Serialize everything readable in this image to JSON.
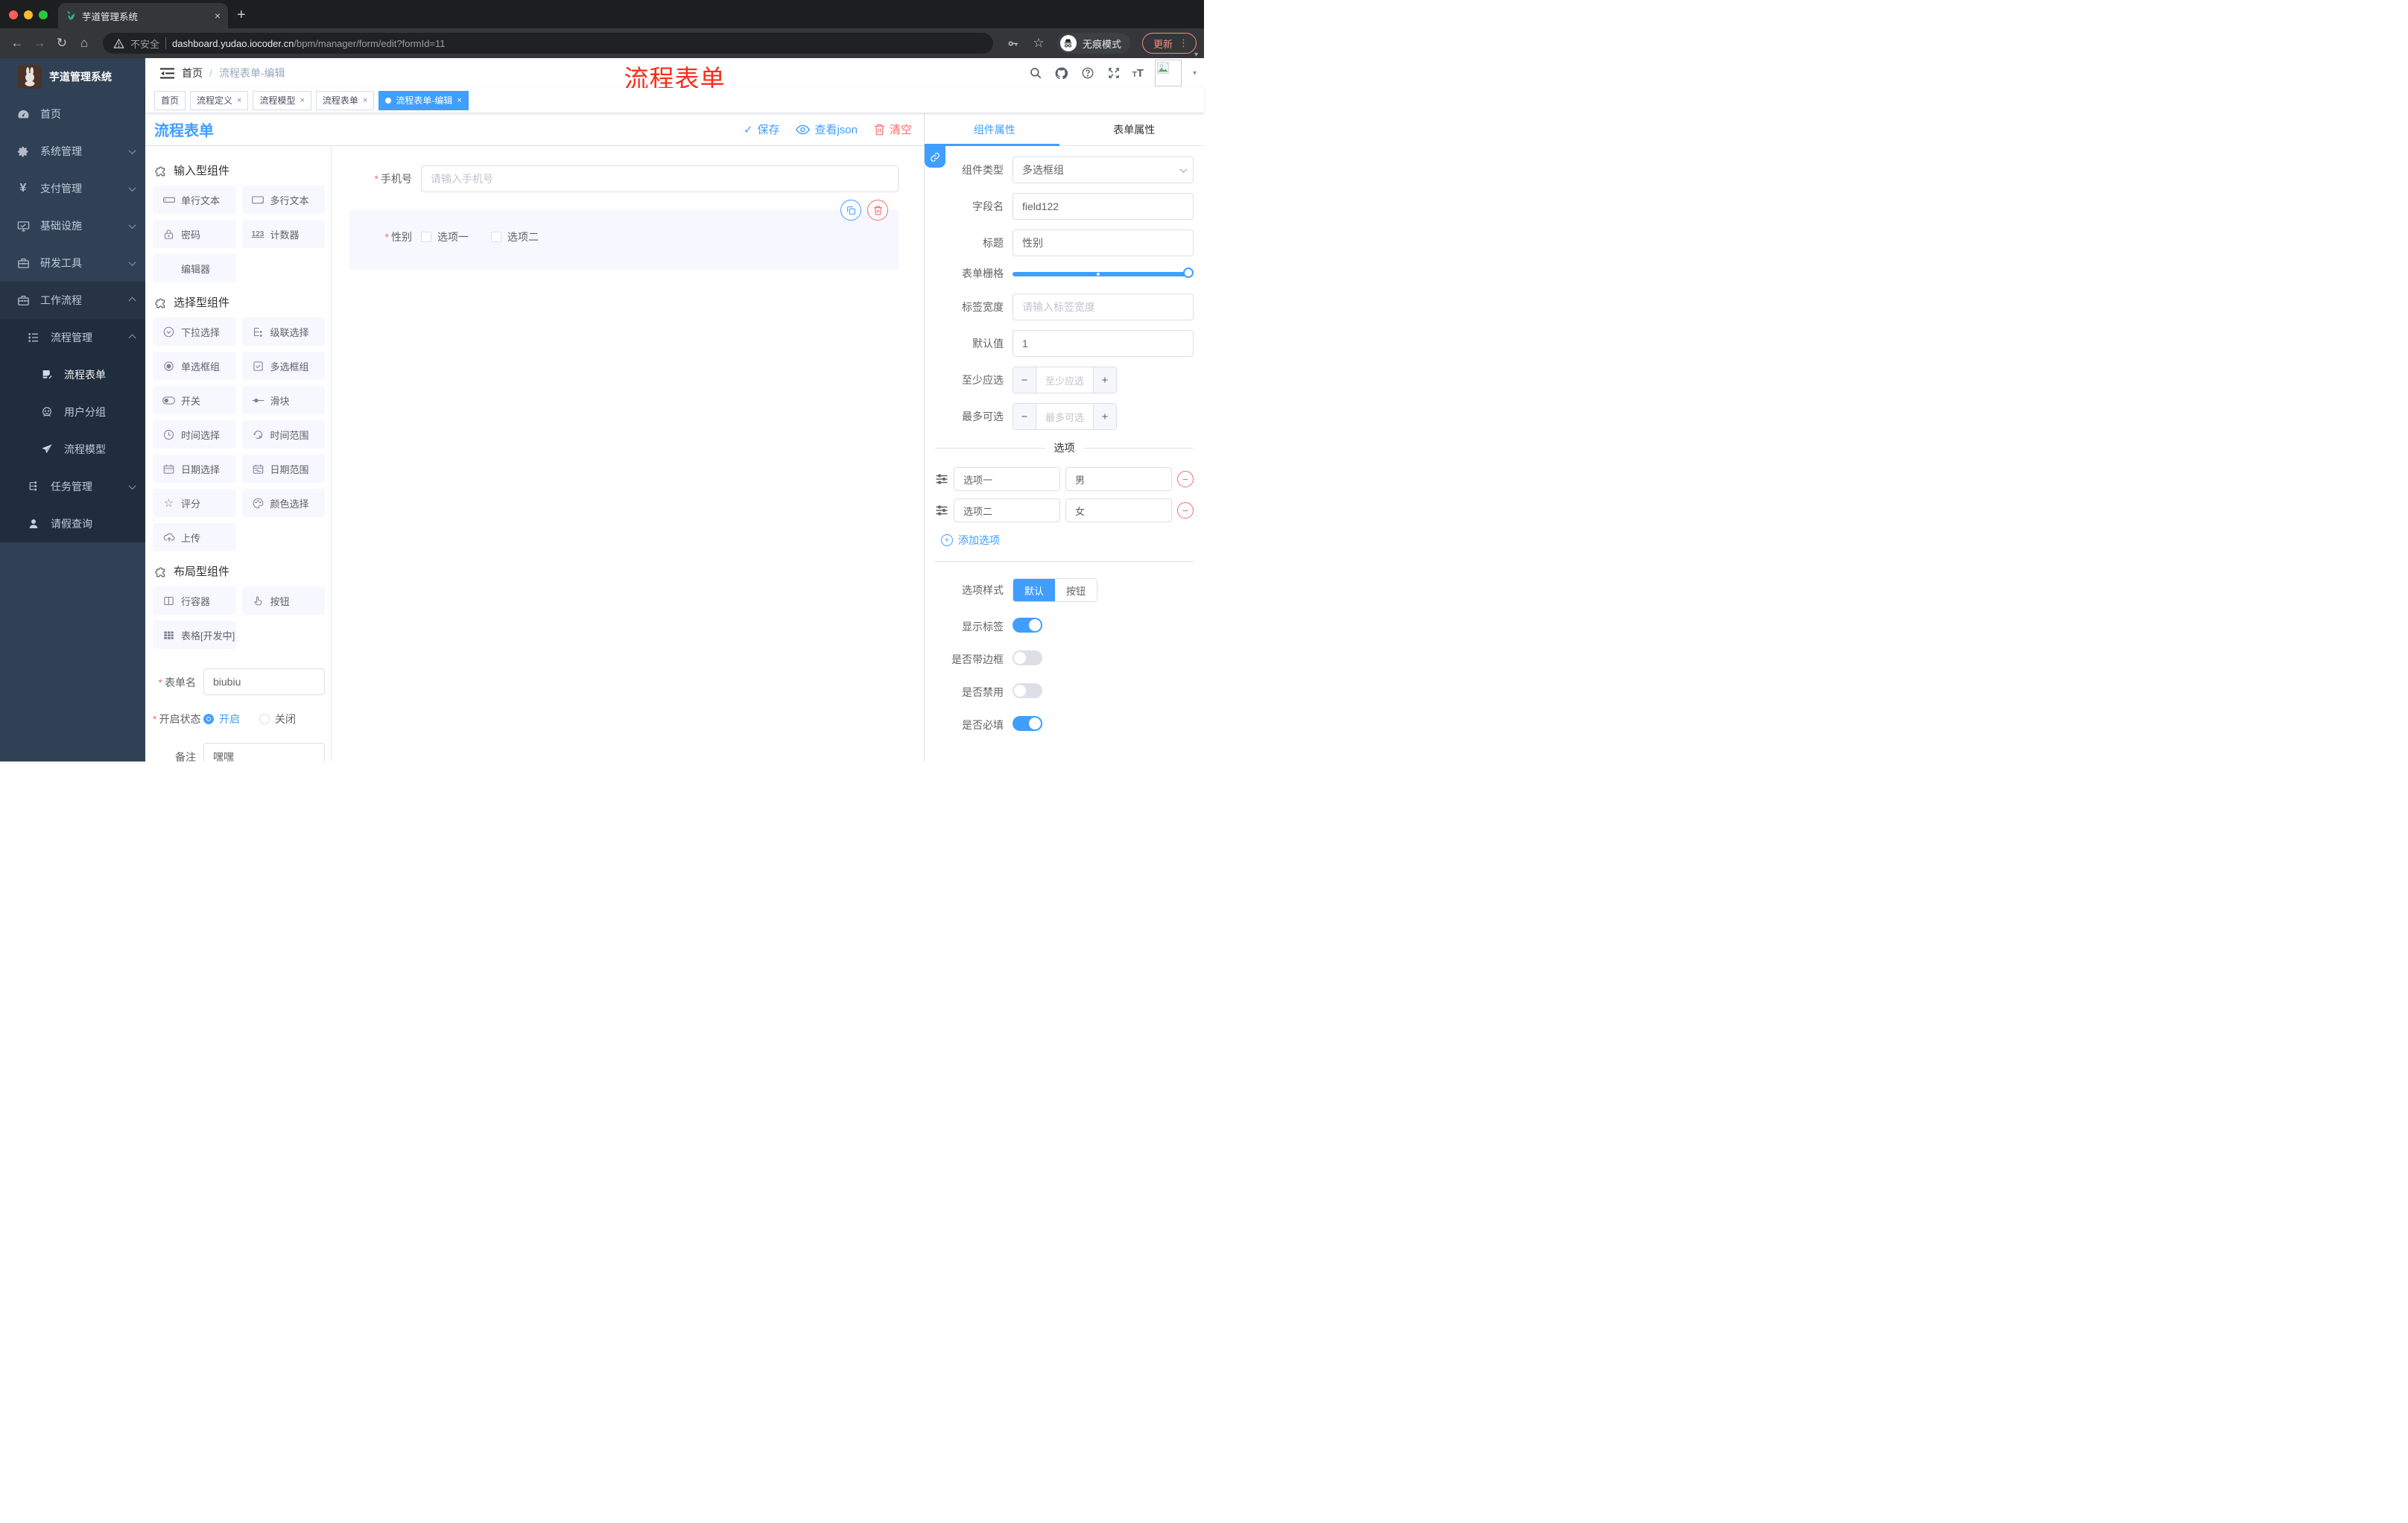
{
  "browser": {
    "tab_title": "芋道管理系统",
    "close_tab": "×",
    "new_tab": "+",
    "back": "←",
    "forward": "→",
    "reload": "↻",
    "home": "⌂",
    "security_label": "不安全",
    "url_domain": "dashboard.yudao.iocoder.cn",
    "url_path": "/bpm/manager/form/edit?formId=11",
    "incognito_label": "无痕模式",
    "update_label": "更新",
    "menu_dots": "⋮",
    "caret": "▾"
  },
  "sidebar": {
    "logo_title": "芋道管理系统",
    "items": [
      {
        "label": "首页",
        "icon": "dashboard-icon"
      },
      {
        "label": "系统管理",
        "icon": "gear-icon"
      },
      {
        "label": "支付管理",
        "icon": "yen-icon",
        "yen": "¥"
      },
      {
        "label": "基础设施",
        "icon": "monitor-icon"
      },
      {
        "label": "研发工具",
        "icon": "toolbox-icon"
      },
      {
        "label": "工作流程",
        "icon": "workflow-icon"
      }
    ],
    "submenu": [
      {
        "label": "流程管理",
        "icon": "list-icon"
      },
      {
        "label": "流程表单",
        "icon": "doc-edit-icon"
      },
      {
        "label": "用户分组",
        "icon": "face-icon"
      },
      {
        "label": "流程模型",
        "icon": "send-icon"
      },
      {
        "label": "任务管理",
        "icon": "tree-icon"
      },
      {
        "label": "请假查询",
        "icon": "user-icon"
      }
    ]
  },
  "header": {
    "breadcrumb": {
      "home": "首页",
      "sep": "/",
      "current": "流程表单-编辑"
    },
    "overlay_title": "流程表单"
  },
  "tags": {
    "t0": "首页",
    "t1": "流程定义",
    "t2": "流程模型",
    "t3": "流程表单",
    "t4": "流程表单-编辑",
    "close": "×"
  },
  "palette": {
    "title": "流程表单",
    "sections": {
      "input": {
        "title": "输入型组件"
      },
      "select": {
        "title": "选择型组件"
      },
      "layout": {
        "title": "布局型组件"
      }
    },
    "items": {
      "single_text": "单行文本",
      "multi_text": "多行文本",
      "password": "密码",
      "counter": "计数器",
      "editor": "编辑器",
      "dropdown": "下拉选择",
      "cascader": "级联选择",
      "radio_group": "单选框组",
      "checkbox_group": "多选框组",
      "switch": "开关",
      "slider": "滑块",
      "time_pick": "时间选择",
      "time_range": "时间范围",
      "date_pick": "日期选择",
      "date_range": "日期范围",
      "rate": "评分",
      "color_pick": "颜色选择",
      "upload": "上传",
      "row_container": "行容器",
      "button": "按钮",
      "table": "表格[开发中]"
    }
  },
  "palette_form": {
    "name_label": "表单名",
    "name_value": "biubiu",
    "status_label": "开启状态",
    "status_on": "开启",
    "status_off": "关闭",
    "remark_label": "备注",
    "remark_value": "嘿嘿"
  },
  "canvas": {
    "toolbar": {
      "save": "保存",
      "view_json": "查看json",
      "clear": "清空"
    },
    "phone_field": {
      "label": "手机号",
      "placeholder": "请输入手机号"
    },
    "gender_field": {
      "label": "性别",
      "option1": "选项一",
      "option2": "选项二"
    }
  },
  "inspector": {
    "tab_component": "组件属性",
    "tab_form": "表单属性",
    "type_label": "组件类型",
    "type_value": "多选框组",
    "field_label": "字段名",
    "field_value": "field122",
    "title_label": "标题",
    "title_value": "性别",
    "grid_label": "表单栅格",
    "width_label": "标签宽度",
    "width_placeholder": "请输入标签宽度",
    "default_label": "默认值",
    "default_value": "1",
    "min_label": "至少应选",
    "min_placeholder": "至少应选",
    "max_label": "最多可选",
    "max_placeholder": "最多可选",
    "options_title": "选项",
    "opt1_label": "选项一",
    "opt1_value": "男",
    "opt2_label": "选项二",
    "opt2_value": "女",
    "add_option": "添加选项",
    "style_label": "选项样式",
    "style_default": "默认",
    "style_button": "按钮",
    "toggle_show_label": "显示标签",
    "toggle_border": "是否带边框",
    "toggle_disabled": "是否禁用",
    "toggle_required": "是否必填"
  },
  "colors": {
    "accent_blue": "#409eff",
    "danger_red": "#f56c6c",
    "overlay_red": "#fb2b19",
    "sidebar_bg": "#304156",
    "submenu_bg": "#1f2d3d",
    "update_salmon": "#f28b82"
  }
}
